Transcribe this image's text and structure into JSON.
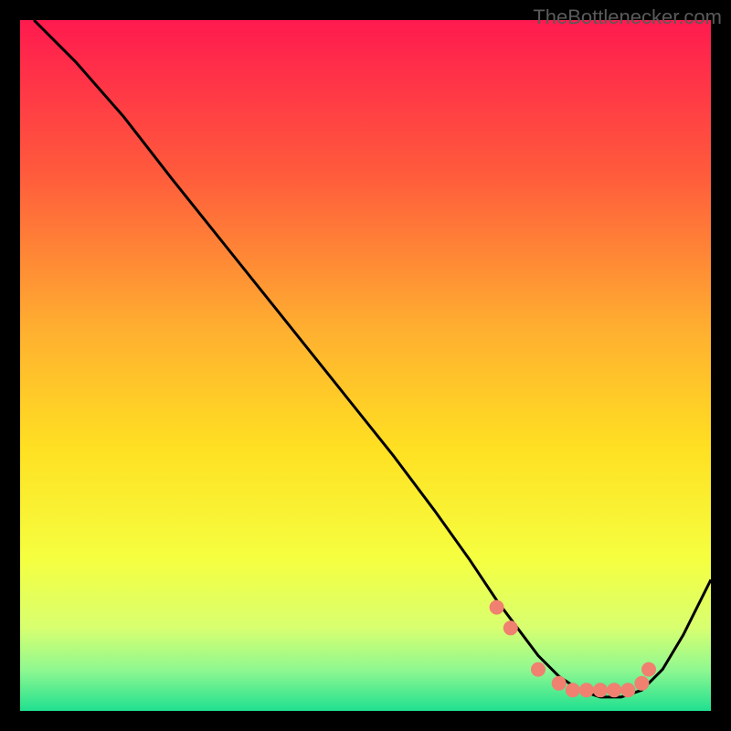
{
  "watermark": "TheBottlenecker.com",
  "chart_data": {
    "type": "line",
    "title": "",
    "xlabel": "",
    "ylabel": "",
    "xlim": [
      0,
      100
    ],
    "ylim": [
      0,
      100
    ],
    "series": [
      {
        "name": "curve",
        "color": "#000000",
        "x": [
          2,
          8,
          15,
          22,
          30,
          38,
          46,
          54,
          60,
          65,
          69,
          72,
          75,
          78,
          81,
          84,
          87,
          90,
          93,
          96,
          100
        ],
        "y": [
          100,
          94,
          86,
          77,
          67,
          57,
          47,
          37,
          29,
          22,
          16,
          12,
          8,
          5,
          3,
          2,
          2,
          3,
          6,
          11,
          19
        ]
      }
    ],
    "markers": {
      "name": "dots",
      "color": "#f08070",
      "x": [
        69,
        71,
        75,
        78,
        80,
        82,
        84,
        86,
        88,
        90,
        91
      ],
      "y": [
        15,
        12,
        6,
        4,
        3,
        3,
        3,
        3,
        3,
        4,
        6
      ]
    },
    "background_gradient": {
      "stops": [
        {
          "offset": 0.0,
          "color": "#ff1a4f"
        },
        {
          "offset": 0.22,
          "color": "#ff5a3c"
        },
        {
          "offset": 0.45,
          "color": "#ffb030"
        },
        {
          "offset": 0.62,
          "color": "#ffe022"
        },
        {
          "offset": 0.78,
          "color": "#f5ff40"
        },
        {
          "offset": 0.88,
          "color": "#d8ff70"
        },
        {
          "offset": 0.94,
          "color": "#90f890"
        },
        {
          "offset": 1.0,
          "color": "#20e090"
        }
      ]
    }
  }
}
